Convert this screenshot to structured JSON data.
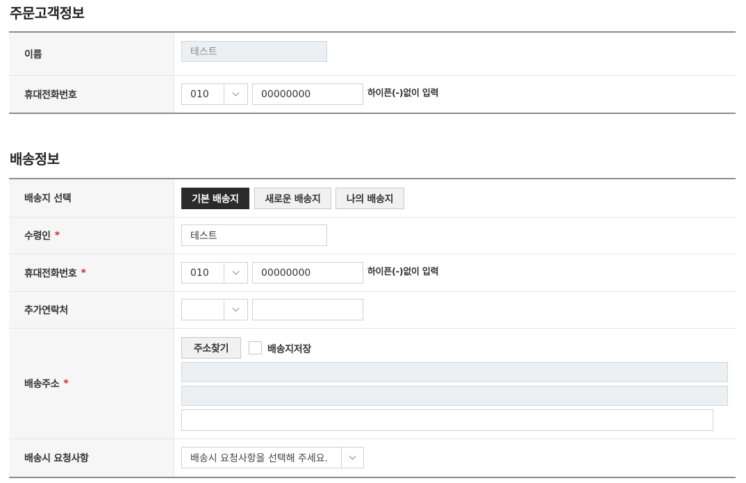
{
  "customer_section": {
    "title": "주문고객정보",
    "name_label": "이름",
    "name_value": "테스트",
    "phone_label": "휴대전화번호",
    "phone_prefix": "010",
    "phone_number": "00000000",
    "phone_hint": "하이픈(-)없이 입력"
  },
  "shipping_section": {
    "title": "배송정보",
    "address_select_label": "배송지 선택",
    "address_buttons": [
      "기본 배송지",
      "새로운 배송지",
      "나의 배송지"
    ],
    "recipient_label": "수령인",
    "recipient_value": "테스트",
    "phone_label": "휴대전화번호",
    "phone_prefix": "010",
    "phone_number": "00000000",
    "phone_hint": "하이픈(-)없이 입력",
    "extra_contact_label": "추가연락처",
    "extra_prefix": "",
    "extra_number": "",
    "address_label": "배송주소",
    "find_address_button": "주소찾기",
    "save_address_label": "배송지저장",
    "request_label": "배송시 요청사항",
    "request_placeholder": "배송시 요청사항을 선택해 주세요.",
    "required_mark": "*"
  },
  "colors": {
    "required": "#d9262c",
    "active_button": "#2b2b2b",
    "label_bg": "#f6f6f6",
    "readonly_bg": "#edf0f3"
  }
}
